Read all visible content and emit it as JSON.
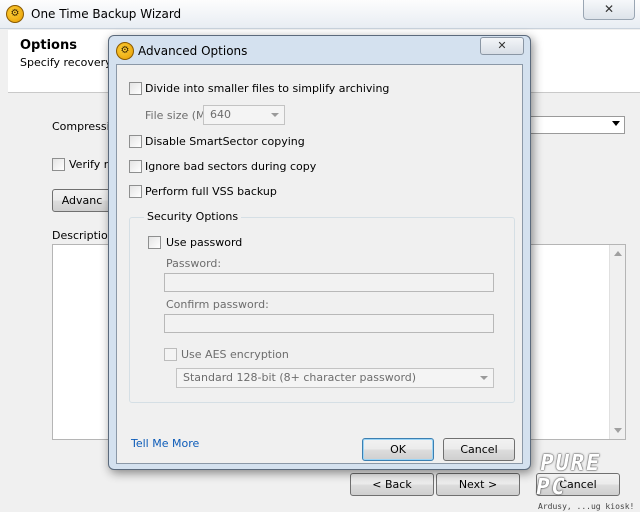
{
  "main": {
    "title": "One Time Backup Wizard",
    "close_glyph": "✕",
    "app_icon": "backup-gear-icon",
    "header": {
      "title": "Options",
      "subtitle": "Specify recovery p"
    },
    "compression_label": "Compressio",
    "verify_label": "Verify re",
    "advanced_button": "Advanc",
    "description_label": "Description",
    "buttons": {
      "back": "< Back",
      "next": "Next >",
      "cancel": "Cancel"
    }
  },
  "dialog": {
    "title": "Advanced Options",
    "close_glyph": "✕",
    "divide_files_label": "Divide into smaller files to simplify archiving",
    "file_size_label": "File size (MB):",
    "file_size_value": "640",
    "disable_smartsector_label": "Disable SmartSector copying",
    "ignore_bad_sectors_label": "Ignore bad sectors during copy",
    "full_vss_label": "Perform full VSS backup",
    "security": {
      "legend": "Security Options",
      "use_password_label": "Use password",
      "password_label": "Password:",
      "confirm_label": "Confirm password:",
      "aes_label": "Use AES encryption",
      "aes_value": "Standard 128-bit (8+ character password)"
    },
    "tell_me_more": "Tell Me More",
    "ok": "OK",
    "cancel": "Cancel"
  },
  "watermark": {
    "big": "PURE PC",
    "small": "Ardusy, ...ug kiosk!"
  },
  "colors": {
    "link": "#0c5bb8",
    "dialog_frame": "#d4e1ef",
    "default_button_border": "#3c7fb1"
  }
}
